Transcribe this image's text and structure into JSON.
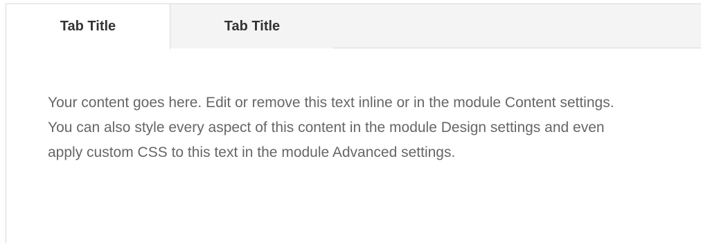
{
  "tabs": [
    {
      "label": "Tab Title",
      "active": true
    },
    {
      "label": "Tab Title",
      "active": false
    }
  ],
  "panel": {
    "text": "Your content goes here. Edit or remove this text inline or in the module Content settings. You can also style every aspect of this content in the module Design settings and even apply custom CSS to this text in the module Advanced settings."
  },
  "colors": {
    "tab_bar_bg": "#f4f4f4",
    "active_tab_bg": "#ffffff",
    "border": "#d9d9d9",
    "tab_text": "#333333",
    "body_text": "#666666"
  }
}
